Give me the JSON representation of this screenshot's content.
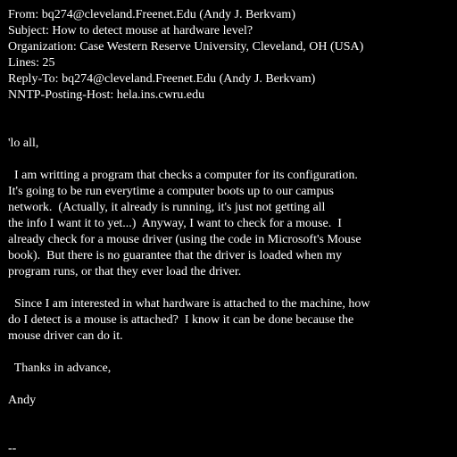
{
  "colors": {
    "background": "#000000",
    "text": "#ffffff"
  },
  "header": {
    "from": "From: bq274@cleveland.Freenet.Edu (Andy J. Berkvam)",
    "subject": "Subject: How to detect mouse at hardware level?",
    "organization": "Organization: Case Western Reserve University, Cleveland, OH (USA)",
    "lines": "Lines: 25",
    "reply_to": "Reply-To: bq274@cleveland.Freenet.Edu (Andy J. Berkvam)",
    "nntp_posting_host": "NNTP-Posting-Host: hela.ins.cwru.edu"
  },
  "body": {
    "greeting": "'lo all,",
    "paragraph1": [
      "  I am writting a program that checks a computer for its configuration.",
      "It's going to be run everytime a computer boots up to our campus",
      "network.  (Actually, it already is running, it's just not getting all",
      "the info I want it to yet...)  Anyway, I want to check for a mouse.  I",
      "already check for a mouse driver (using the code in Microsoft's Mouse",
      "book).  But there is no guarantee that the driver is loaded when my",
      "program runs, or that they ever load the driver."
    ],
    "paragraph2": [
      "  Since I am interested in what hardware is attached to the machine, how",
      "do I detect is a mouse is attached?  I know it can be done because the",
      "mouse driver can do it."
    ],
    "thanks": "  Thanks in advance,",
    "signature": "Andy",
    "sig_separator": "--"
  }
}
